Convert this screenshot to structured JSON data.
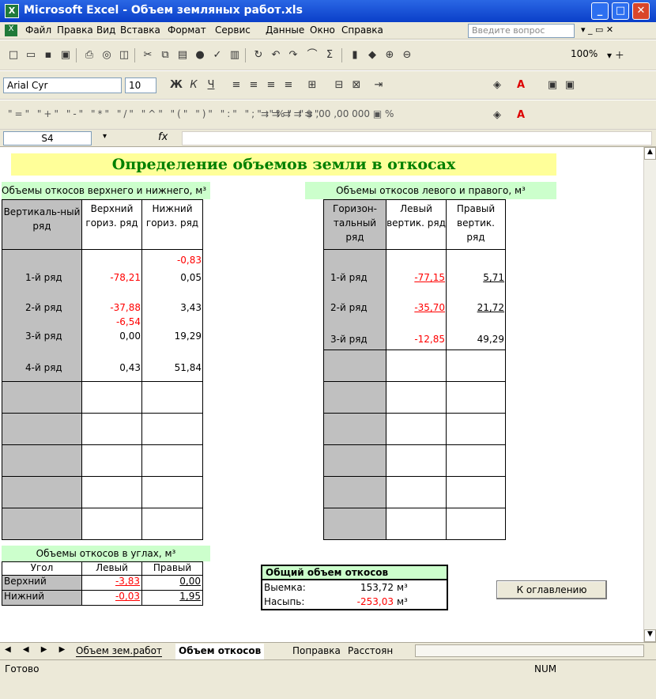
{
  "window": {
    "title": "Microsoft Excel - Объем земляных работ.xls"
  },
  "menu": {
    "items": [
      "Файл",
      "Правка",
      "Вид",
      "Вставка",
      "Формат",
      "Сервис",
      "Данные",
      "Окно",
      "Справка"
    ],
    "help_placeholder": "Введите вопрос"
  },
  "toolbar": {
    "zoom": "100%",
    "font": "Arial Cyr",
    "font_size": "10"
  },
  "formula_bar": {
    "cell_ref": "S4",
    "fx": "fx"
  },
  "sheet": {
    "title": "Определение объемов земли в откосах",
    "section_vert": "Объемы откосов верхнего и нижнего, м³",
    "section_horiz": "Объемы откосов левого и правого, м³",
    "vert_headers": [
      "Вертикаль-ный ряд",
      "Верхний гориз. ряд",
      "Нижний гориз. ряд"
    ],
    "horiz_headers": [
      "Горизон-тальный ряд",
      "Левый вертик. ряд",
      "Правый вертик. ряд"
    ],
    "vert_rows": [
      {
        "label": "1-й ряд",
        "upper": "-78,21",
        "lower_top": "-0,83",
        "lower": "0,05"
      },
      {
        "label": "2-й ряд",
        "upper": "-37,88",
        "lower": "3,43"
      },
      {
        "label": "3-й ряд",
        "upper_top": "-6,54",
        "upper": "0,00",
        "lower": "19,29"
      },
      {
        "label": "4-й ряд",
        "upper": "0,43",
        "lower": "51,84"
      }
    ],
    "horiz_rows": [
      {
        "label": "1-й ряд",
        "left": "-77,15",
        "right": "5,71"
      },
      {
        "label": "2-й ряд",
        "left": "-35,70",
        "right": "21,72"
      },
      {
        "label": "3-й ряд",
        "left": "-12,85",
        "right": "49,29"
      }
    ],
    "corners": {
      "title": "Объемы откосов в углах, м³",
      "headers": [
        "Угол",
        "Левый",
        "Правый"
      ],
      "rows": [
        {
          "label": "Верхний",
          "left": "-3,83",
          "right": "0,00"
        },
        {
          "label": "Нижний",
          "left": "-0,03",
          "right": "1,95"
        }
      ]
    },
    "total": {
      "title": "Общий объем откосов",
      "cut_label": "Выемка:",
      "cut_value": "153,72",
      "fill_label": "Насыпь:",
      "fill_value": "-253,03",
      "unit": "м³"
    },
    "toc_button": "К оглавлению"
  },
  "tabs": [
    "Объем зем.работ",
    "Объем откосов",
    "Поправка",
    "Расстоян"
  ],
  "status": {
    "left": "Готово",
    "num": "NUM"
  },
  "colors": {
    "title_bg": "#ffff99",
    "section_bg": "#ccffcc",
    "grey": "#c0c0c0",
    "negative": "#ff0000"
  }
}
